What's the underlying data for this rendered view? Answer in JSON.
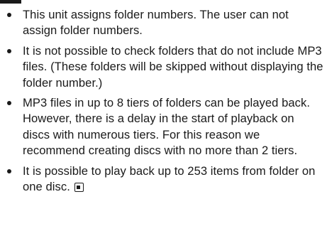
{
  "notes": [
    {
      "text": "This unit assigns folder numbers. The user can not assign folder numbers."
    },
    {
      "text": "It is not possible to check folders that do not include MP3 files. (These folders will be skipped without displaying the folder number.)"
    },
    {
      "text": "MP3 files in up to 8 tiers of folders can be played back. However, there is a delay in the start of playback on discs with numerous tiers. For this reason we recommend creating discs with no more than 2 tiers."
    },
    {
      "text": "It is possible to play back up to 253 items from folder on one disc."
    }
  ],
  "end_mark_icon": "section-end-icon",
  "colors": {
    "text": "#1a1a1a",
    "background": "#ffffff"
  }
}
